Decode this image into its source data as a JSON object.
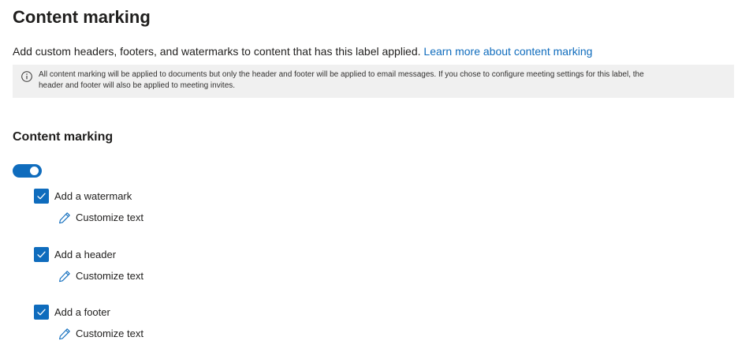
{
  "header": {
    "title": "Content marking",
    "description": "Add custom headers, footers, and watermarks to content that has this label applied. ",
    "learn_more_link": "Learn more about content marking"
  },
  "info_bar": {
    "icon": "info-icon",
    "line1": "All content marking will be applied to documents but only the header and footer will be applied to email messages. If you chose to configure meeting settings for this label, the",
    "line2": "header and footer will also be applied to meeting invites."
  },
  "section": {
    "title": "Content marking",
    "toggle_on": true
  },
  "options": [
    {
      "label": "Add a watermark",
      "checked": true,
      "customize_label": "Customize text"
    },
    {
      "label": "Add a header",
      "checked": true,
      "customize_label": "Customize text"
    },
    {
      "label": "Add a footer",
      "checked": true,
      "customize_label": "Customize text"
    }
  ],
  "colors": {
    "accent": "#0f6cbd",
    "info_bg": "#f0f0f0",
    "text": "#201f1e"
  }
}
